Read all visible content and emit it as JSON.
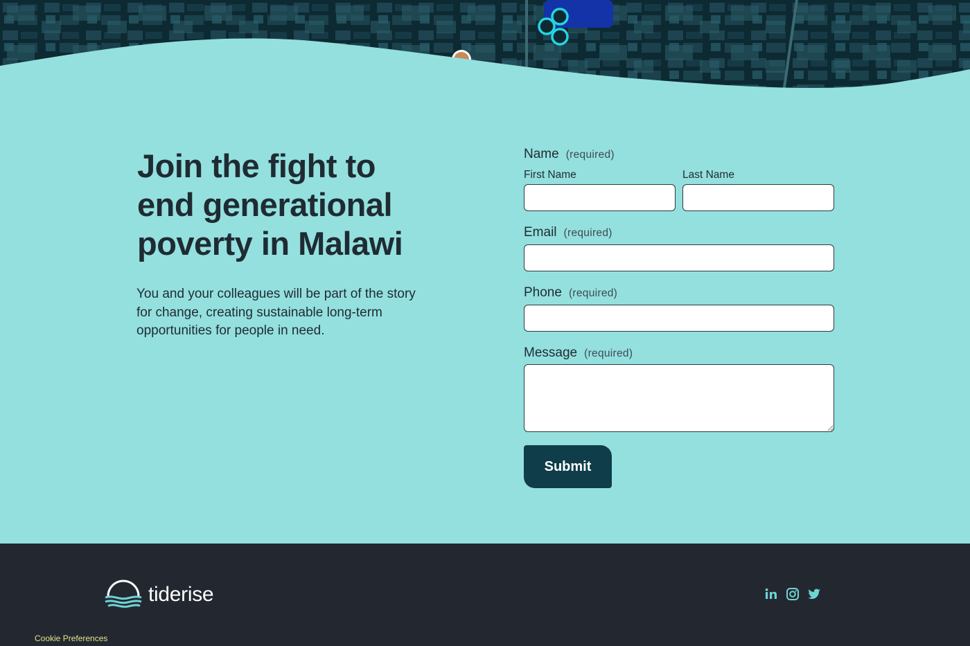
{
  "hero": {
    "alt_icon": "map-cluster-icon"
  },
  "headline": {
    "line1": "Join the fight to",
    "line2": "end generational",
    "line3": "poverty in Malawi"
  },
  "subtext": "You and your colleagues will be part of the story for change, creating sustainable long-term opportunities for people in need.",
  "form": {
    "name": {
      "label": "Name",
      "required": "(required)"
    },
    "first_name": {
      "label": "First Name",
      "value": ""
    },
    "last_name": {
      "label": "Last Name",
      "value": ""
    },
    "email": {
      "label": "Email",
      "required": "(required)",
      "value": ""
    },
    "phone": {
      "label": "Phone",
      "required": "(required)",
      "value": ""
    },
    "message": {
      "label": "Message",
      "required": "(required)",
      "value": ""
    },
    "submit_label": "Submit"
  },
  "footer": {
    "brand": "tiderise",
    "social_icons": [
      "linkedin-icon",
      "instagram-icon",
      "twitter-icon"
    ],
    "cookie_label": "Cookie Preferences"
  },
  "colors": {
    "page_bg": "#94e0de",
    "text": "#1f2b33",
    "button_bg": "#0f3d4a",
    "footer_bg": "#232830",
    "social": "#6fd3d3",
    "cookie": "#e6e28a"
  }
}
